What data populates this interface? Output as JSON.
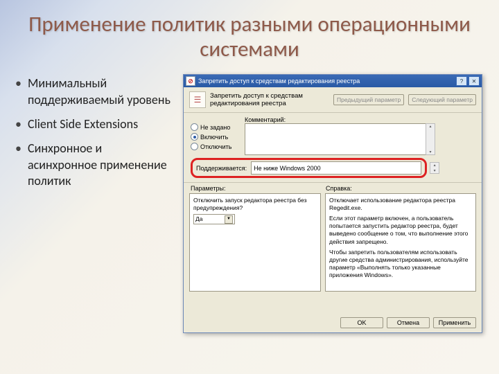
{
  "title": "Применение политик разными операционными системами",
  "bullets": [
    "Минимальный поддерживаемый уровень",
    "Client Side Extensions",
    "Синхронное и асинхронное применение политик"
  ],
  "dialog": {
    "window_title": "Запретить доступ к средствам редактирования реестра",
    "header_label": "Запретить доступ к средствам редактирования реестра",
    "nav_prev": "Предыдущий параметр",
    "nav_next": "Следующий параметр",
    "radios": {
      "not_set": "Не задано",
      "enable": "Включить",
      "disable": "Отключить"
    },
    "comment_label": "Комментарий:",
    "supported_label": "Поддерживается:",
    "supported_value": "Не ниже Windows 2000",
    "section_params": "Параметры:",
    "section_help": "Справка:",
    "left_panel": {
      "question": "Отключить запуск редактора реестра без предупреждения?",
      "dropdown_value": "Да"
    },
    "right_panel": {
      "p1": "Отключает использование редактора реестра Regedit.exe.",
      "p2": "Если этот параметр включен, а пользователь попытается запустить редактор реестра, будет выведено сообщение о том, что выполнение этого действия запрещено.",
      "p3": "Чтобы запретить пользователям использовать другие средства администрирования, используйте параметр «Выполнять только указанные приложения Windows»."
    },
    "buttons": {
      "ok": "OK",
      "cancel": "Отмена",
      "apply": "Применить"
    }
  }
}
